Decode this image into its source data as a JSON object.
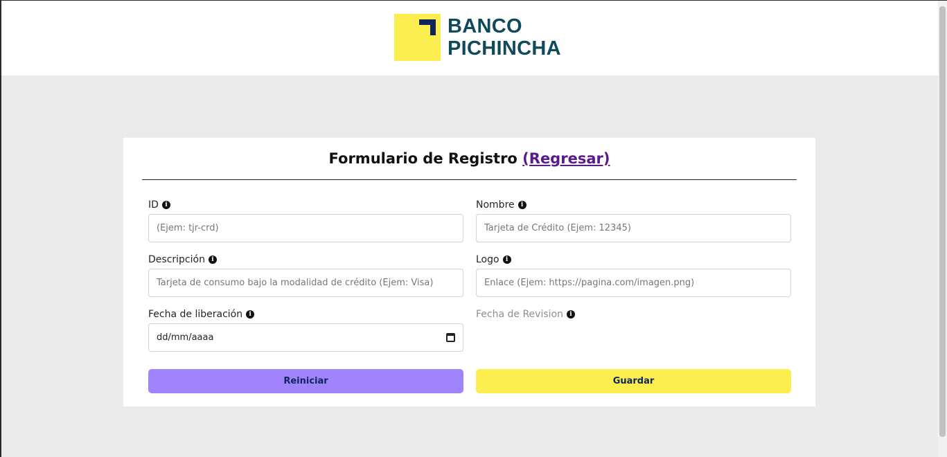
{
  "brand": {
    "line1": "BANCO",
    "line2": "PICHINCHA",
    "mark_color": "#fcee4e",
    "text_color": "#0f4a5a"
  },
  "form": {
    "title": "Formulario de Registro",
    "back_link": "(Regresar)",
    "fields": {
      "id": {
        "label": "ID",
        "placeholder": "(Ejem: tjr-crd)"
      },
      "nombre": {
        "label": "Nombre",
        "placeholder": "Tarjeta de Crédito (Ejem: 12345)"
      },
      "descripcion": {
        "label": "Descripción",
        "placeholder": "Tarjeta de consumo bajo la modalidad de crédito (Ejem: Visa)"
      },
      "logo": {
        "label": "Logo",
        "placeholder": "Enlace (Ejem: https://pagina.com/imagen.png)"
      },
      "fecha_liberacion": {
        "label": "Fecha de liberación",
        "value": "dd/mm/aaaa"
      },
      "fecha_revision": {
        "label": "Fecha de Revision"
      }
    },
    "buttons": {
      "reset": "Reiniciar",
      "save": "Guardar"
    },
    "info_icon_glyph": "i"
  },
  "colors": {
    "reset_button": "#a084fb",
    "save_button": "#fcee4e",
    "link": "#5a1a8e",
    "background": "#ebebeb"
  }
}
